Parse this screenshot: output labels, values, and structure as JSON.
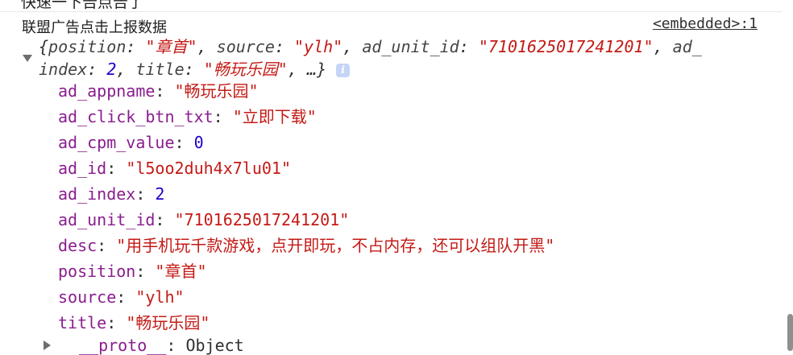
{
  "console": {
    "top_partial": "快速一下告点告了",
    "message": "联盟广告点击上报数据",
    "source_link": "<embedded>:1",
    "preview": {
      "open_brace": "{",
      "position_key": "position",
      "position_val": "\"章首\"",
      "source_key": "source",
      "source_val": "\"ylh\"",
      "ad_unit_id_key": "ad_unit_id",
      "ad_unit_id_val": "\"7101625017241201\"",
      "ad_partial": "ad_",
      "index_key": "index",
      "index_val": "2",
      "title_key": "title",
      "title_val": "\"畅玩乐园\"",
      "ellipsis": "…}",
      "info_badge": "i"
    },
    "properties": [
      {
        "key": "ad_appname",
        "value": "\"畅玩乐园\"",
        "type": "string"
      },
      {
        "key": "ad_click_btn_txt",
        "value": "\"立即下载\"",
        "type": "string"
      },
      {
        "key": "ad_cpm_value",
        "value": "0",
        "type": "number"
      },
      {
        "key": "ad_id",
        "value": "\"l5oo2duh4x7lu01\"",
        "type": "string"
      },
      {
        "key": "ad_index",
        "value": "2",
        "type": "number"
      },
      {
        "key": "ad_unit_id",
        "value": "\"7101625017241201\"",
        "type": "string"
      },
      {
        "key": "desc",
        "value": "\"用手机玩千款游戏，点开即玩，不占内存，还可以组队开黑\"",
        "type": "string"
      },
      {
        "key": "position",
        "value": "\"章首\"",
        "type": "string"
      },
      {
        "key": "source",
        "value": "\"ylh\"",
        "type": "string"
      },
      {
        "key": "title",
        "value": "\"畅玩乐园\"",
        "type": "string"
      }
    ],
    "proto": {
      "key": "__proto__",
      "value": "Object"
    },
    "colors": {
      "key": "#8a1e8e",
      "string": "#c41a16",
      "number": "#1c00cf",
      "arrow": "#6e6e6e"
    },
    "icons": {
      "expand": "triangle-down-icon",
      "collapsed": "triangle-right-icon",
      "info": "info-icon"
    }
  }
}
